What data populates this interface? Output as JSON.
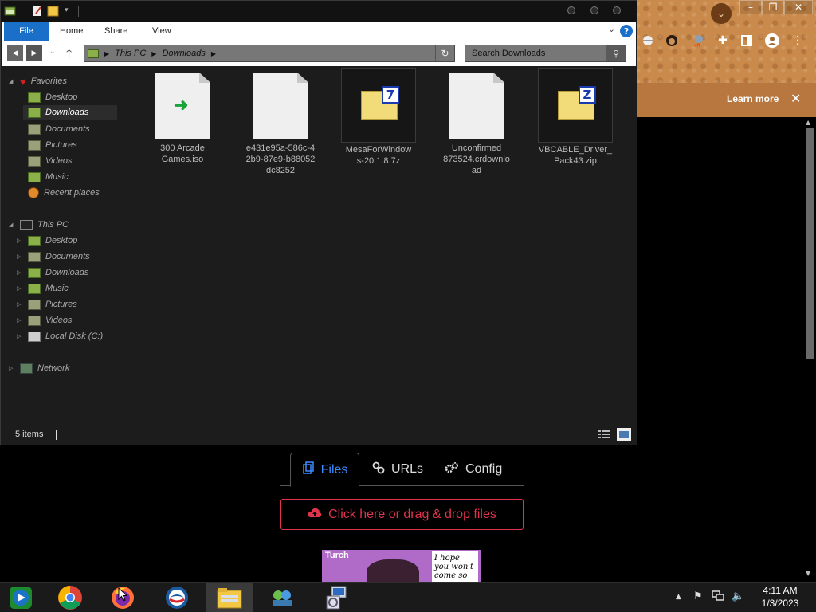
{
  "explorer": {
    "ribbon_tabs": [
      "File",
      "Home",
      "Share",
      "View"
    ],
    "breadcrumb": [
      "This PC",
      "Downloads"
    ],
    "search_placeholder": "Search Downloads",
    "help_label": "?",
    "nav": {
      "favorites_label": "Favorites",
      "favorites": [
        "Desktop",
        "Downloads",
        "Documents",
        "Pictures",
        "Videos",
        "Music",
        "Recent places"
      ],
      "thispc_label": "This PC",
      "thispc": [
        "Desktop",
        "Documents",
        "Downloads",
        "Music",
        "Pictures",
        "Videos",
        "Local Disk (C:)"
      ],
      "network_label": "Network"
    },
    "files": [
      {
        "name_lines": [
          "300 Arcade",
          "Games.iso"
        ],
        "icon": "iso-file-icon"
      },
      {
        "name_lines": [
          "e431e95a-586c-4",
          "2b9-87e9-b88052",
          "dc8252"
        ],
        "icon": "blank-file-icon"
      },
      {
        "name_lines": [
          "MesaForWindow",
          "s-20.1.8.7z"
        ],
        "icon": "7z-archive-icon",
        "badge": "7"
      },
      {
        "name_lines": [
          "Unconfirmed",
          "873524.crdownlo",
          "ad"
        ],
        "icon": "blank-file-icon"
      },
      {
        "name_lines": [
          "VBCABLE_Driver_",
          "Pack43.zip"
        ],
        "icon": "zip-archive-icon",
        "badge": "Z"
      }
    ],
    "status": "5 items"
  },
  "browser": {
    "banner_link": "Learn more",
    "banner_close": "✕",
    "tabs": [
      {
        "label": "Files",
        "icon": "files-icon"
      },
      {
        "label": "URLs",
        "icon": "link-icon"
      },
      {
        "label": "Config",
        "icon": "gear-icon"
      }
    ],
    "upload_label": "Click here or drag & drop files",
    "comic": {
      "title": "Turch",
      "bubble": "I hope you won't come so"
    }
  },
  "taskbar": {
    "apps": [
      "windows-media-center",
      "chrome",
      "firefox",
      "opera",
      "file-explorer",
      "network-app",
      "installer"
    ],
    "time": "4:11 AM",
    "date": "1/3/2023"
  },
  "colors": {
    "accent_blue": "#1a70c8",
    "upload_red": "#e0344d",
    "tab_active_blue": "#3a8cff"
  }
}
